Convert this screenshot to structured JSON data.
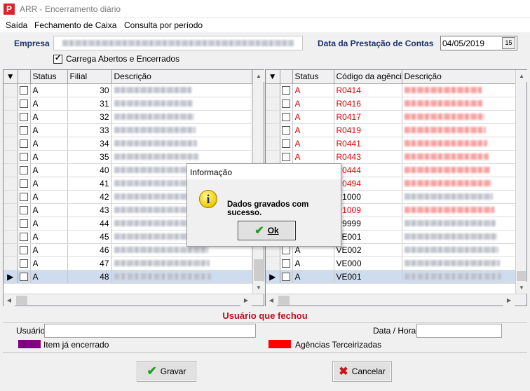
{
  "window": {
    "title": "ARR - Encerramento diário",
    "app_icon_glyph": "P"
  },
  "menu": [
    "Saída",
    "Fechamento de Caixa",
    "Consulta por período"
  ],
  "header": {
    "empresa_label": "Empresa",
    "data_label": "Data da Prestação de Contas",
    "data_value": "04/05/2019",
    "calendar_btn_label": "15",
    "carrega_label": "Carrega Abertos e Encerrados",
    "carrega_checked": true
  },
  "left_grid": {
    "columns": [
      "Status",
      "Filial",
      "Descrição"
    ],
    "rows": [
      {
        "status": "A",
        "filial": "30"
      },
      {
        "status": "A",
        "filial": "31"
      },
      {
        "status": "A",
        "filial": "32"
      },
      {
        "status": "A",
        "filial": "33"
      },
      {
        "status": "A",
        "filial": "34"
      },
      {
        "status": "A",
        "filial": "35"
      },
      {
        "status": "A",
        "filial": "40"
      },
      {
        "status": "A",
        "filial": "41"
      },
      {
        "status": "A",
        "filial": "42"
      },
      {
        "status": "A",
        "filial": "43"
      },
      {
        "status": "A",
        "filial": "44"
      },
      {
        "status": "A",
        "filial": "45"
      },
      {
        "status": "A",
        "filial": "46"
      },
      {
        "status": "A",
        "filial": "47"
      },
      {
        "status": "A",
        "filial": "48"
      }
    ]
  },
  "right_grid": {
    "columns": [
      "Status",
      "Código da agência",
      "Descrição"
    ],
    "rows": [
      {
        "status": "A",
        "codigo": "R0414",
        "red": true
      },
      {
        "status": "A",
        "codigo": "R0416",
        "red": true
      },
      {
        "status": "A",
        "codigo": "R0417",
        "red": true
      },
      {
        "status": "A",
        "codigo": "R0419",
        "red": true
      },
      {
        "status": "A",
        "codigo": "R0441",
        "red": true
      },
      {
        "status": "A",
        "codigo": "R0443",
        "red": true
      },
      {
        "status": "A",
        "codigo": "R0444",
        "red": true
      },
      {
        "status": "A",
        "codigo": "R0494",
        "red": true
      },
      {
        "status": "A",
        "codigo": "R1000",
        "red": false
      },
      {
        "status": "A",
        "codigo": "R1009",
        "red": true
      },
      {
        "status": "A",
        "codigo": "R9999",
        "red": false
      },
      {
        "status": "A",
        "codigo": "VE001",
        "red": false
      },
      {
        "status": "A",
        "codigo": "VE002",
        "red": false
      },
      {
        "status": "A",
        "codigo": "VE000",
        "red": false
      },
      {
        "status": "A",
        "codigo": "VE001",
        "red": false
      }
    ]
  },
  "usuario_section": {
    "title": "Usuário que fechou",
    "usuario_label": "Usuário",
    "data_hora_label": "Data / Hora",
    "legend_encerrado": "Item já encerrado",
    "legend_terceirizadas": "Agências Terceirizadas",
    "color_encerrado": "#800080",
    "color_terceirizadas": "#ff0000"
  },
  "buttons": {
    "gravar": "Gravar",
    "cancelar": "Cancelar"
  },
  "dialog": {
    "title": "Informação",
    "message": "Dados gravados com sucesso.",
    "ok_label": "Ok"
  }
}
